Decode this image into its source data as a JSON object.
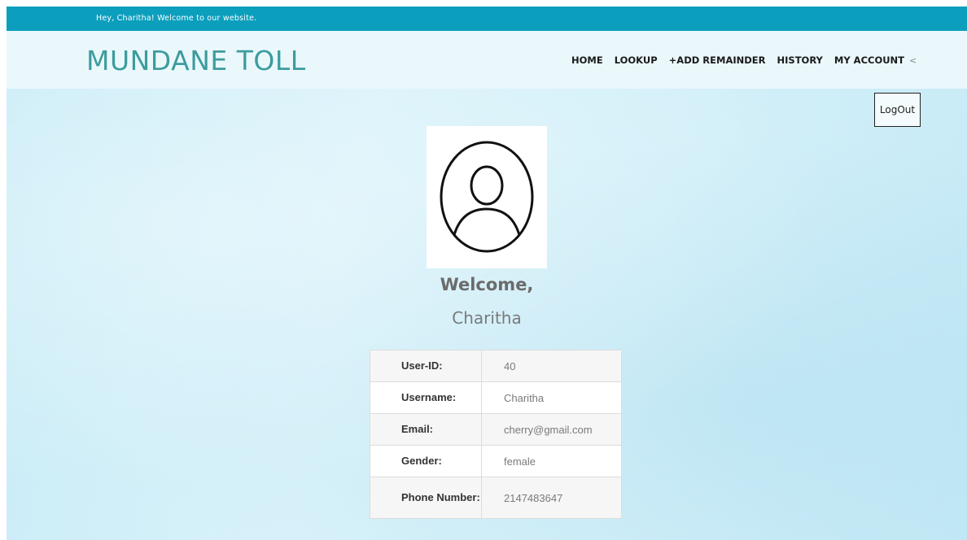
{
  "top_bar": {
    "greeting": "Hey, Charitha! Welcome to our website."
  },
  "header": {
    "logo": "MUNDANE TOLL",
    "nav": {
      "home": "HOME",
      "lookup": "LOOKUP",
      "add_reminder": "+ADD REMAINDER",
      "history": "HISTORY",
      "my_account": "MY ACCOUNT",
      "caret": "<"
    }
  },
  "main": {
    "logout_label": "LogOut",
    "avatar_icon": "user-circle-icon",
    "welcome_title": "Welcome,",
    "welcome_name": "Charitha"
  },
  "profile": {
    "rows": [
      {
        "label": "User-ID:",
        "value": "40"
      },
      {
        "label": "Username:",
        "value": "Charitha"
      },
      {
        "label": "Email:",
        "value": "cherry@gmail.com"
      },
      {
        "label": "Gender:",
        "value": "female"
      },
      {
        "label": "Phone Number:",
        "value": "2147483647"
      }
    ]
  },
  "colors": {
    "top_bar": "#0b9fbd",
    "logo": "#3d9c9e",
    "header_bg": "#eaf8fc"
  }
}
